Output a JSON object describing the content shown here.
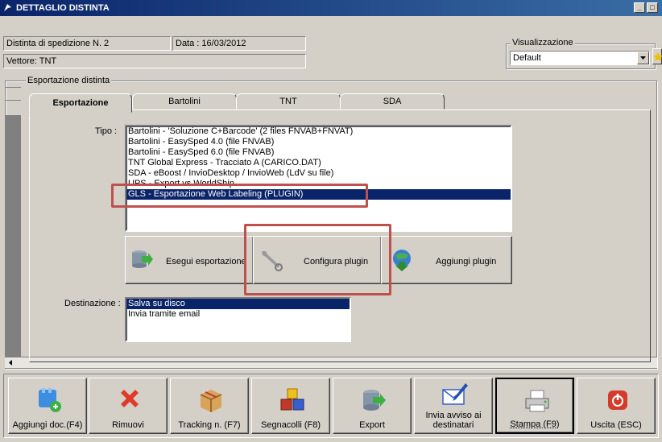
{
  "window": {
    "title": "DETTAGLIO DISTINTA",
    "btn_min": "_",
    "btn_max": "□"
  },
  "header": {
    "distinta": "Distinta di spedizione N. 2",
    "data": "Data : 16/03/2012",
    "vettore": "Vettore: TNT",
    "visualizzazione_label": "Visualizzazione",
    "visualizzazione_value": "Default"
  },
  "group": {
    "label": "Esportazione distinta"
  },
  "tabs": [
    {
      "label": "Esportazione"
    },
    {
      "label": "Bartolini"
    },
    {
      "label": "TNT"
    },
    {
      "label": "SDA"
    }
  ],
  "tipo": {
    "label": "Tipo :",
    "items": [
      "Bartolini - 'Soluzione C+Barcode' (2 files FNVAB+FNVAT)",
      "Bartolini - EasySped 4.0 (file FNVAB)",
      "Bartolini - EasySped 6.0 (file FNVAB)",
      "TNT Global Express - Tracciato A (CARICO.DAT)",
      "SDA - eBoost / InvioDesktop / InvioWeb (LdV su file)",
      "UPS - Export vs WorldShip",
      "GLS - Esportazione Web Labeling (PLUGIN)"
    ]
  },
  "actions": {
    "esegui": "Esegui esportazione",
    "configura": "Configura plugin",
    "aggiungi": "Aggiungi plugin"
  },
  "destinazione": {
    "label": "Destinazione :",
    "items": [
      "Salva su disco",
      "Invia tramite email"
    ]
  },
  "toolbar": {
    "aggiungi_doc": "Aggiungi doc.(F4)",
    "rimuovi": "Rimuovi",
    "tracking": "Tracking n. (F7)",
    "segnacolli": "Segnacolli (F8)",
    "export": "Export",
    "invia_avviso_1": "Invia avviso ai",
    "invia_avviso_2": "destinatari",
    "stampa": "Stampa (F9)",
    "uscita": "Uscita (ESC)"
  }
}
